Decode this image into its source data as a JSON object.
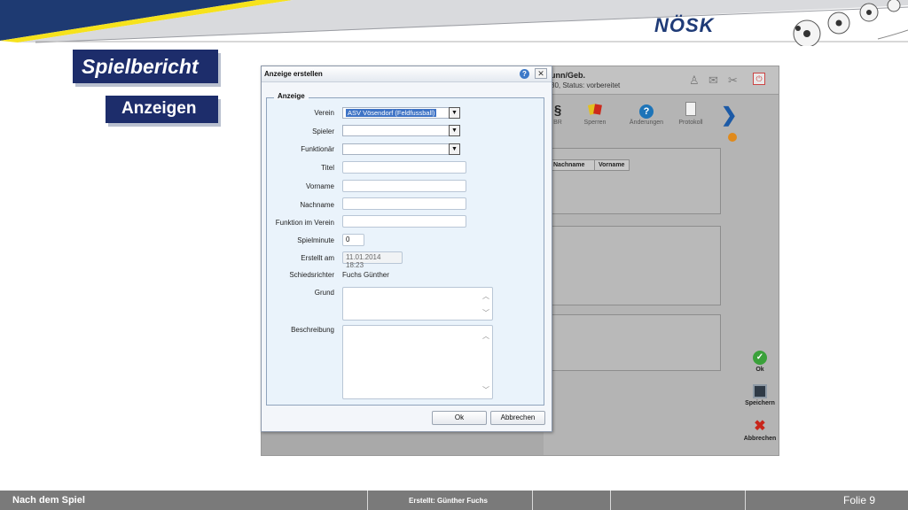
{
  "slide": {
    "logo": "NÖSK",
    "title": "Spielbericht",
    "subtitle": "Anzeigen"
  },
  "background_window": {
    "header_title": "unn/Geb.",
    "header_status": "30, Status: vorbereitet",
    "toolbar": [
      {
        "label": "BR",
        "icon": "paragraph-icon"
      },
      {
        "label": "Sperren",
        "icon": "cards-icon"
      },
      {
        "label": "Änderungen",
        "icon": "question-icon"
      },
      {
        "label": "Protokoll",
        "icon": "document-icon"
      }
    ],
    "table_headers": [
      "Nachname",
      "Vorname"
    ],
    "side_buttons": [
      {
        "label": "Ok",
        "icon": "check-icon"
      },
      {
        "label": "Speichern",
        "icon": "save-icon"
      },
      {
        "label": "Abbrechen",
        "icon": "cancel-icon"
      }
    ]
  },
  "dialog": {
    "title": "Anzeige erstellen",
    "legend": "Anzeige",
    "fields": {
      "verein": {
        "label": "Verein",
        "value": "ASV Vösendorf (Feldfussball)"
      },
      "spieler": {
        "label": "Spieler",
        "value": ""
      },
      "funktionaer": {
        "label": "Funktionär",
        "value": ""
      },
      "titel": {
        "label": "Titel",
        "value": ""
      },
      "vorname": {
        "label": "Vorname",
        "value": ""
      },
      "nachname": {
        "label": "Nachname",
        "value": ""
      },
      "funktion": {
        "label": "Funktion im Verein",
        "value": ""
      },
      "spielminute": {
        "label": "Spielminute",
        "value": "0"
      },
      "erstellt": {
        "label": "Erstellt am",
        "value": "11.01.2014 18:23"
      },
      "schiedsrichter": {
        "label": "Schiedsrichter",
        "value": "Fuchs Günther"
      },
      "grund": {
        "label": "Grund",
        "value": ""
      },
      "beschreibung": {
        "label": "Beschreibung",
        "value": ""
      }
    },
    "ok_label": "Ok",
    "cancel_label": "Abbrechen"
  },
  "footer": {
    "left": "Nach dem Spiel",
    "center": "Erstellt: Günther Fuchs",
    "right": "Folie  9"
  },
  "colors": {
    "title_bg": "#1d2d6b",
    "header_yellow": "#f6e21c",
    "header_blue": "#1f3b77",
    "footer_bg": "#7a7a7a"
  }
}
